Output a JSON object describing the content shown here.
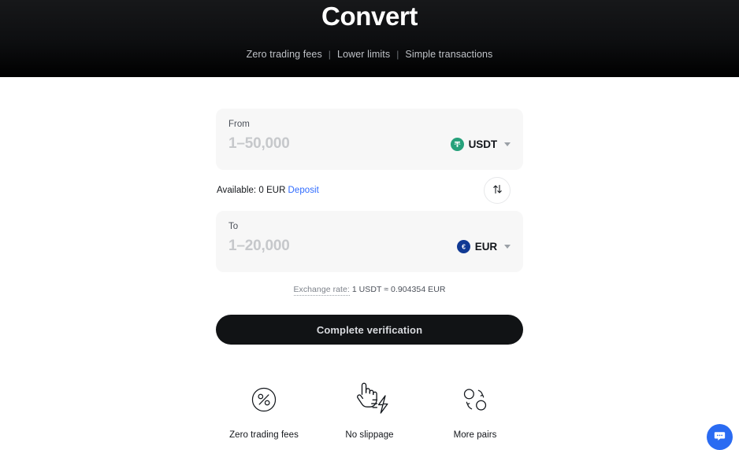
{
  "hero": {
    "title": "Convert",
    "tagline_items": [
      "Zero trading fees",
      "Lower limits",
      "Simple transactions"
    ],
    "separator": "|",
    "bg_color": "#000000",
    "title_color": "#ffffff",
    "tagline_color": "#bfc2c7"
  },
  "convert": {
    "from": {
      "label": "From",
      "placeholder": "1–50,000",
      "value": "",
      "coin": {
        "symbol": "USDT",
        "icon": "tether-icon",
        "icon_color": "#26a17b"
      }
    },
    "to": {
      "label": "To",
      "placeholder": "1–20,000",
      "value": "",
      "coin": {
        "symbol": "EUR",
        "icon": "euro-icon",
        "icon_color": "#113a94"
      }
    },
    "balance": {
      "text": "Available: 0 EUR",
      "deposit_link": "Deposit",
      "link_color": "#2f6bff"
    },
    "swap": {
      "icon": "swap-vertical-icon",
      "title": "Swap currencies"
    },
    "rate": {
      "label": "Exchange rate:",
      "value": "1 USDT ≈ 0.904354 EUR"
    },
    "cta": {
      "label": "Complete verification",
      "bg_color": "#111315",
      "text_color": "#d8dade"
    }
  },
  "features": [
    {
      "label": "Zero trading fees",
      "icon": "percent-circle-icon"
    },
    {
      "label": "No slippage",
      "icon": "hand-lightning-icon"
    },
    {
      "label": "More pairs",
      "icon": "swap-circles-icon"
    }
  ],
  "chat": {
    "icon": "chat-bubble-icon",
    "bg_color": "#2a6bf2"
  }
}
